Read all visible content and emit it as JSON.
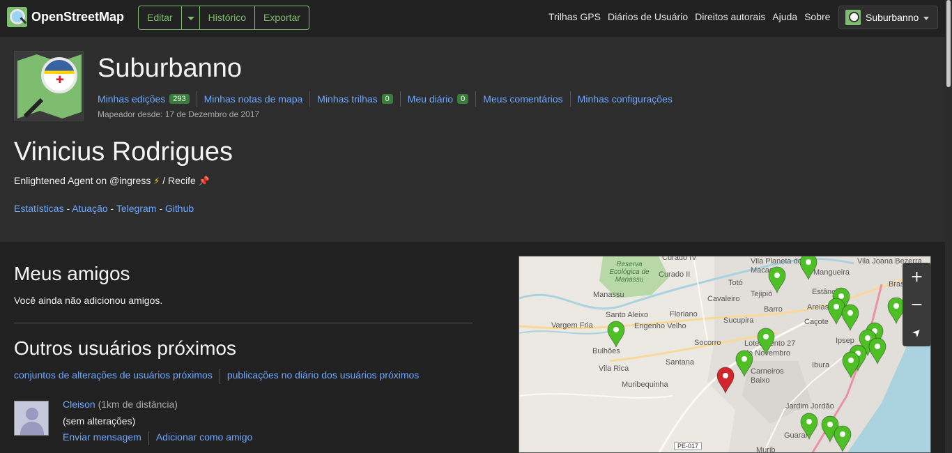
{
  "header": {
    "brand": "OpenStreetMap",
    "edit_label": "Editar",
    "history_label": "Histórico",
    "export_label": "Exportar",
    "nav": [
      "Trilhas GPS",
      "Diários de Usuário",
      "Direitos autorais",
      "Ajuda",
      "Sobre"
    ],
    "user_menu_label": "Suburbanno"
  },
  "profile": {
    "username": "Suburbanno",
    "links": [
      {
        "label": "Minhas edições",
        "badge": "293"
      },
      {
        "label": "Minhas notas de mapa",
        "badge": ""
      },
      {
        "label": "Minhas trilhas",
        "badge": "0"
      },
      {
        "label": "Meu diário",
        "badge": "0"
      },
      {
        "label": "Meus comentários",
        "badge": ""
      },
      {
        "label": "Minhas configurações",
        "badge": ""
      }
    ],
    "mapper_since": "Mapeador desde: 17 de Dezembro de 2017",
    "display_name": "Vinicius Rodrigues",
    "bio_prefix": "Enlightened Agent on @ingress",
    "bio_bolt": "⚡",
    "bio_middle": "/ Recife",
    "bio_pin": "📌",
    "external_links": [
      "Estatísticas",
      "Atuação",
      "Telegram",
      "Github"
    ],
    "separator": "-"
  },
  "friends": {
    "title": "Meus amigos",
    "empty_note": "Você ainda não adicionou amigos."
  },
  "nearby": {
    "title": "Outros usuários próximos",
    "links": [
      "conjuntos de alterações de usuários próximos",
      "publicações no diário dos usuários próximos"
    ],
    "users": [
      {
        "name": "Cleison",
        "distance": "(1km de distância)",
        "status": "(sem alterações)",
        "actions": [
          "Enviar mensagem",
          "Adicionar como amigo"
        ]
      }
    ]
  },
  "map": {
    "place_labels": [
      "Curado IV",
      "Vila Planeta dos Macacos",
      "Mangueira",
      "Vila Joana Bezerra",
      "Reserva Ecológica de Manassu",
      "Curado II",
      "Totó",
      "Brasília Teim",
      "Estância",
      "Manassu",
      "Tejipió",
      "Cavaleiro",
      "Barro",
      "Areias",
      "Vargem Fria",
      "Santo Aleixo",
      "Floriano",
      "Sucupira",
      "Caçote",
      "Engenho Velho",
      "Socorro",
      "Loteamento 27 de Novembro",
      "Ipsep",
      "Bulhões",
      "Vila Rica",
      "Santana",
      "Carneiros Baixo",
      "Ibura",
      "Muribequinha",
      "Jardim Jordão",
      "Guarar",
      "Murib"
    ],
    "road_label": "PE-017",
    "zoom_in": "+",
    "zoom_out": "−",
    "locate": "➤",
    "colors": {
      "marker": "#4fbf26",
      "marker_self": "#d3252c",
      "water": "#aad3df",
      "forest": "#b9d8a8"
    }
  }
}
